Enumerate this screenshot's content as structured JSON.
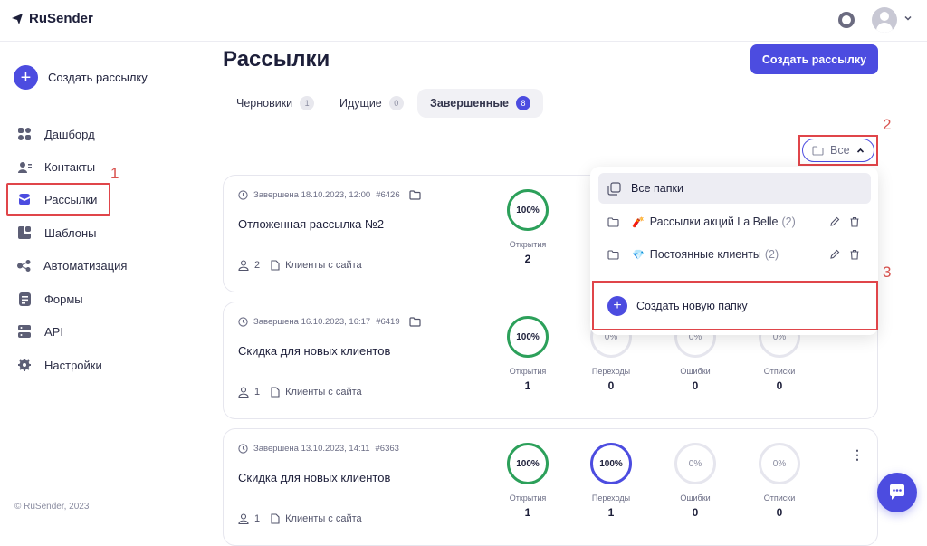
{
  "header": {
    "logo_text": "RuSender"
  },
  "sidebar": {
    "create_label": "Создать рассылку",
    "items": [
      {
        "label": "Дашборд",
        "icon": "dashboard-icon"
      },
      {
        "label": "Контакты",
        "icon": "contacts-icon"
      },
      {
        "label": "Рассылки",
        "icon": "mailing-icon",
        "active": true
      },
      {
        "label": "Шаблоны",
        "icon": "templates-icon"
      },
      {
        "label": "Автоматизация",
        "icon": "automation-icon"
      },
      {
        "label": "Формы",
        "icon": "forms-icon"
      },
      {
        "label": "API",
        "icon": "api-icon"
      },
      {
        "label": "Настройки",
        "icon": "settings-icon"
      }
    ],
    "copyright": "© RuSender, 2023"
  },
  "annotations": {
    "a1": "1",
    "a2": "2",
    "a3": "3"
  },
  "page": {
    "title": "Рассылки",
    "create_button": "Создать рассылку"
  },
  "tabs": [
    {
      "label": "Черновики",
      "count": "1"
    },
    {
      "label": "Идущие",
      "count": "0"
    },
    {
      "label": "Завершенные",
      "count": "8",
      "active": true
    }
  ],
  "filter": {
    "label": "Все"
  },
  "dropdown": {
    "all_label": "Все папки",
    "folders": [
      {
        "emoji": "🧨",
        "name": "Рассылки акций La Belle",
        "count": "(2)"
      },
      {
        "emoji": "💎",
        "name": "Постоянные клиенты",
        "count": "(2)"
      }
    ],
    "create_folder": "Создать новую папку"
  },
  "stat_labels": {
    "opens": "Открытия",
    "clicks": "Переходы",
    "errors": "Ошибки",
    "unsubs": "Отписки"
  },
  "campaigns": [
    {
      "status": "Завершена 18.10.2023, 12:00",
      "id": "#6426",
      "title": "Отложенная рассылка №2",
      "recipients": "2",
      "source": "Клиенты с сайта",
      "opens_pct": "100%",
      "opens": "2"
    },
    {
      "status": "Завершена 16.10.2023, 16:17",
      "id": "#6419",
      "title": "Скидка для новых клиентов",
      "recipients": "1",
      "source": "Клиенты с сайта",
      "opens_pct": "100%",
      "opens": "1",
      "clicks_pct": "0%",
      "clicks": "0",
      "errors_pct": "0%",
      "errors": "0",
      "unsubs_pct": "0%",
      "unsubs": "0"
    },
    {
      "status": "Завершена 13.10.2023, 14:11",
      "id": "#6363",
      "title": "Скидка для новых клиентов",
      "recipients": "1",
      "source": "Клиенты с сайта",
      "opens_pct": "100%",
      "opens": "1",
      "clicks_pct": "100%",
      "clicks": "1",
      "errors_pct": "0%",
      "errors": "0",
      "unsubs_pct": "0%",
      "unsubs": "0"
    }
  ],
  "colors": {
    "accent": "#4c4ce0",
    "highlight": "#e0454a",
    "success": "#2ca05a"
  }
}
